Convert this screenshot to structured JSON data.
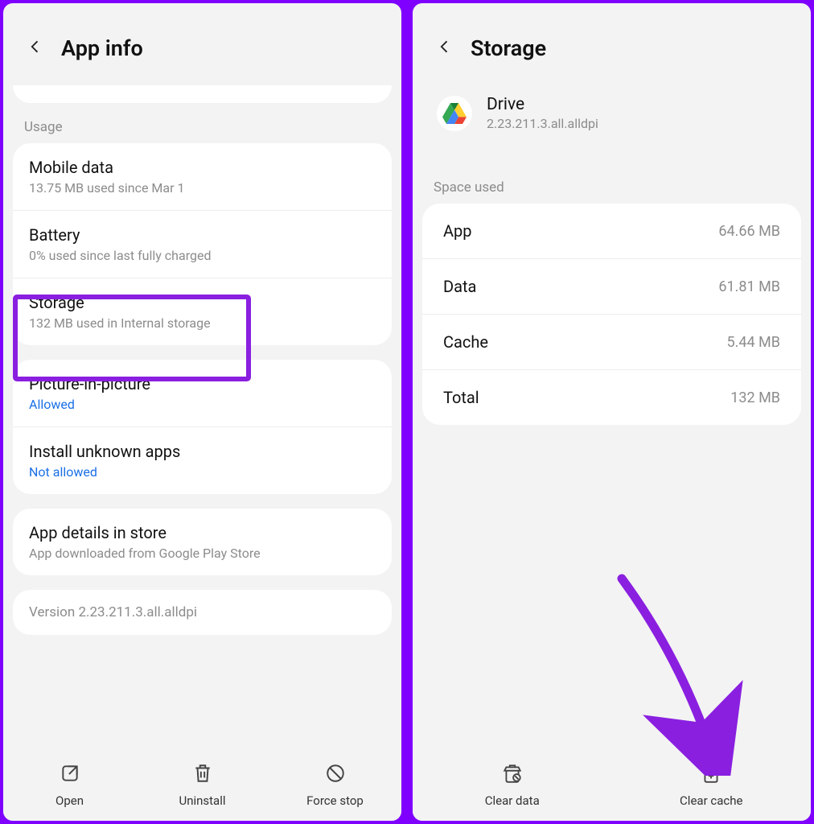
{
  "left": {
    "title": "App info",
    "usage_label": "Usage",
    "mobile_data": {
      "title": "Mobile data",
      "sub": "13.75 MB used since Mar 1"
    },
    "battery": {
      "title": "Battery",
      "sub": "0% used since last fully charged"
    },
    "storage": {
      "title": "Storage",
      "sub": "132 MB used in Internal storage"
    },
    "pip": {
      "title": "Picture-in-picture",
      "sub": "Allowed"
    },
    "unknown": {
      "title": "Install unknown apps",
      "sub": "Not allowed"
    },
    "store": {
      "title": "App details in store",
      "sub": "App downloaded from Google Play Store"
    },
    "version": "Version 2.23.211.3.all.alldpi",
    "buttons": {
      "open": "Open",
      "uninstall": "Uninstall",
      "force_stop": "Force stop"
    }
  },
  "right": {
    "title": "Storage",
    "app_name": "Drive",
    "app_version": "2.23.211.3.all.alldpi",
    "space_used_label": "Space used",
    "rows": {
      "app": {
        "label": "App",
        "value": "64.66 MB"
      },
      "data": {
        "label": "Data",
        "value": "61.81 MB"
      },
      "cache": {
        "label": "Cache",
        "value": "5.44 MB"
      },
      "total": {
        "label": "Total",
        "value": "132 MB"
      }
    },
    "buttons": {
      "clear_data": "Clear data",
      "clear_cache": "Clear cache"
    }
  }
}
